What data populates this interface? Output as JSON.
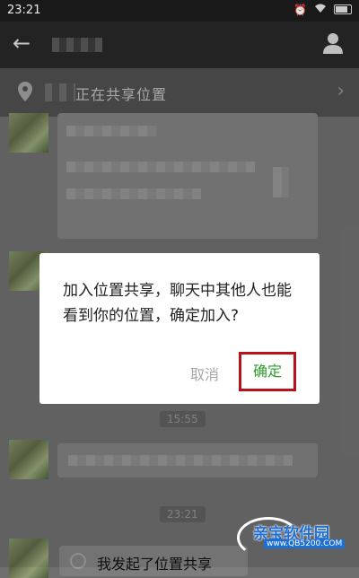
{
  "status_bar": {
    "time": "23:21"
  },
  "banner": {
    "text": "正在共享位置"
  },
  "messages": {
    "time_1": "15:55",
    "time_2": "23:21",
    "last_message": "我发起了位置共享"
  },
  "dialog": {
    "message": "加入位置共享，聊天中其他人也能看到你的位置，确定加入?",
    "cancel_label": "取消",
    "ok_label": "确定"
  },
  "watermark": {
    "title": "亲宝软件园",
    "url": "www.QB5200.COM"
  },
  "colors": {
    "ok_green": "#2e9d2e",
    "highlight_red": "#b5121b",
    "watermark_blue": "#1e6fd4"
  }
}
